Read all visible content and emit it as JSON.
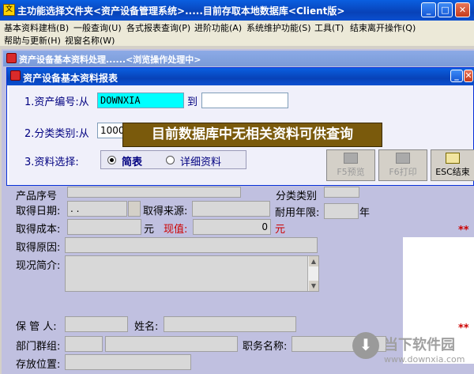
{
  "window": {
    "title": "主功能选择文件夹<资产设备管理系统>.....目前存取本地数据库<Client版>",
    "app_icon": "文",
    "buttons": {
      "minimize": "_",
      "maximize": "□",
      "close": "✕"
    }
  },
  "menu": {
    "items": [
      "基本资料建档(B)",
      "一般查询(U)",
      "各式报表查询(P)",
      "进阶功能(A)",
      "系统维护功能(S)",
      "工具(T)",
      "结束离开操作(Q)",
      "帮助与更新(H)",
      "视窗名称(W)"
    ]
  },
  "child_window": {
    "title": "资产设备基本资料处理......<浏览操作处理中>"
  },
  "report_window": {
    "title": "资产设备基本资料报表",
    "row1": {
      "label": "1.资产编号:从",
      "from_value": "DOWNXIA",
      "to_label": "到",
      "to_value": ""
    },
    "row2": {
      "label": "2.分类类别:从",
      "from_value": "10000"
    },
    "row3": {
      "label": "3.资料选择:",
      "option_brief": "简表",
      "option_detail": "详细资料",
      "selected": "简表"
    },
    "buttons": {
      "preview": "F5预览",
      "print": "F6打印",
      "exit": "ESC结束"
    },
    "control_buttons": {
      "minimize": "_",
      "close": "✕"
    }
  },
  "popup_message": "目前数据库中无相关资料可供查询",
  "form": {
    "product_no": "产品序号",
    "category": "分类类别",
    "acquire_date_label": "取得日期:",
    "acquire_date_value": ". .",
    "acquire_source_label": "取得来源:",
    "useful_life_label": "耐用年限:",
    "year_unit": "年",
    "cost_label": "取得成本:",
    "yuan1": "元",
    "current_value_label": "现值:",
    "current_value": "0",
    "yuan2": "元",
    "reason_label": "取得原因:",
    "summary_label": "现况简介:",
    "custodian_label": "保 管 人:",
    "name_label": "姓名:",
    "dept_label": "部门群组:",
    "title_label": "职务名称:",
    "location_label": "存放位置:",
    "stars": "**"
  },
  "watermark": {
    "cn": "当下软件园",
    "url": "www.downxia.com"
  }
}
